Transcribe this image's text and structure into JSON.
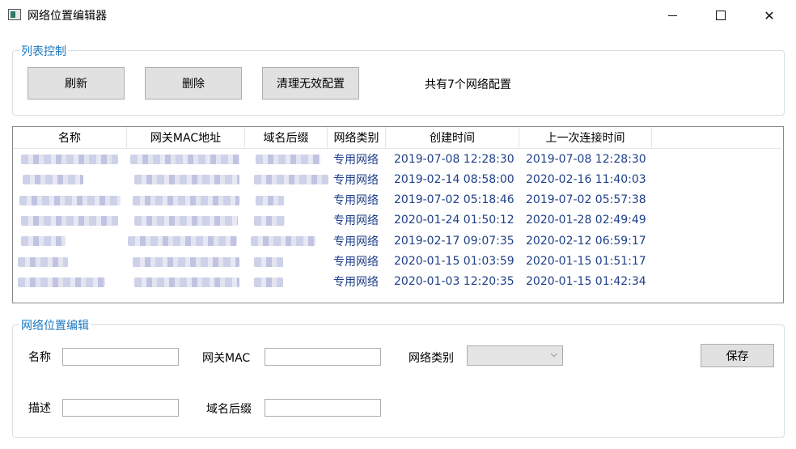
{
  "window": {
    "title": "网络位置编辑器"
  },
  "list_control": {
    "group_label": "列表控制",
    "refresh_label": "刷新",
    "delete_label": "删除",
    "clean_label": "清理无效配置",
    "count_text": "共有7个网络配置"
  },
  "table": {
    "columns": [
      "名称",
      "网关MAC地址",
      "域名后缀",
      "网络类别",
      "创建时间",
      "上一次连接时间"
    ],
    "rows": [
      {
        "type": "专用网络",
        "created": "2019-07-08 12:28:30",
        "last": "2019-07-08 12:28:30"
      },
      {
        "type": "专用网络",
        "created": "2019-02-14 08:58:00",
        "last": "2020-02-16 11:40:03"
      },
      {
        "type": "专用网络",
        "created": "2019-07-02 05:18:46",
        "last": "2019-07-02 05:57:38"
      },
      {
        "type": "专用网络",
        "created": "2020-01-24 01:50:12",
        "last": "2020-01-28 02:49:49"
      },
      {
        "type": "专用网络",
        "created": "2019-02-17 09:07:35",
        "last": "2020-02-12 06:59:17"
      },
      {
        "type": "专用网络",
        "created": "2020-01-15 01:03:59",
        "last": "2020-01-15 01:51:17"
      },
      {
        "type": "专用网络",
        "created": "2020-01-03 12:20:35",
        "last": "2020-01-15 01:42:34"
      }
    ]
  },
  "editor": {
    "group_label": "网络位置编辑",
    "name_label": "名称",
    "mac_label": "网关MAC",
    "type_label": "网络类别",
    "desc_label": "描述",
    "suffix_label": "域名后缀",
    "save_label": "保存",
    "name_value": "",
    "mac_value": "",
    "desc_value": "",
    "suffix_value": "",
    "type_value": ""
  }
}
